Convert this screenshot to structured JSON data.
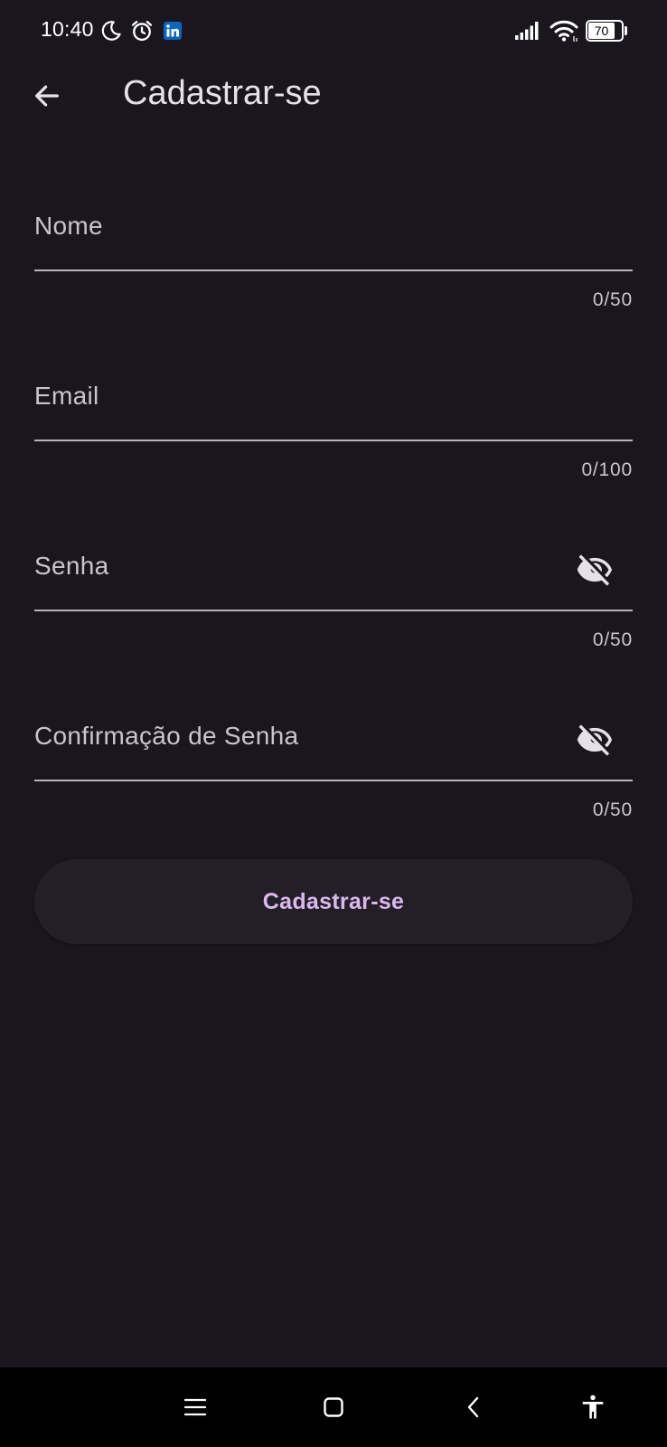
{
  "status_bar": {
    "time": "10:40",
    "battery": "70",
    "icons": [
      "moon-icon",
      "alarm-icon",
      "linkedin-icon",
      "signal-icon",
      "wifi-icon",
      "battery-icon"
    ],
    "linkedin_color": "#0a66c2"
  },
  "app_bar": {
    "title": "Cadastrar-se",
    "back_icon": "arrow-back-icon"
  },
  "form": {
    "fields": [
      {
        "label": "Nome",
        "value": "",
        "counter": "0/50",
        "has_visibility_toggle": false
      },
      {
        "label": "Email",
        "value": "",
        "counter": "0/100",
        "has_visibility_toggle": false
      },
      {
        "label": "Senha",
        "value": "",
        "counter": "0/50",
        "has_visibility_toggle": true,
        "toggle_icon": "eye-off-icon"
      },
      {
        "label": "Confirmação de Senha",
        "value": "",
        "counter": "0/50",
        "has_visibility_toggle": true,
        "toggle_icon": "eye-off-icon"
      }
    ],
    "submit_label": "Cadastrar-se"
  },
  "nav_bar": {
    "items": [
      "menu-icon",
      "home-icon",
      "back-icon",
      "accessibility-icon"
    ]
  },
  "colors": {
    "background": "#1a161d",
    "text_primary": "#e6e0e9",
    "text_secondary": "#cac4d0",
    "accent": "#dcb8f0",
    "button_surface": "#231f26",
    "divider": "#b9b3c0"
  }
}
